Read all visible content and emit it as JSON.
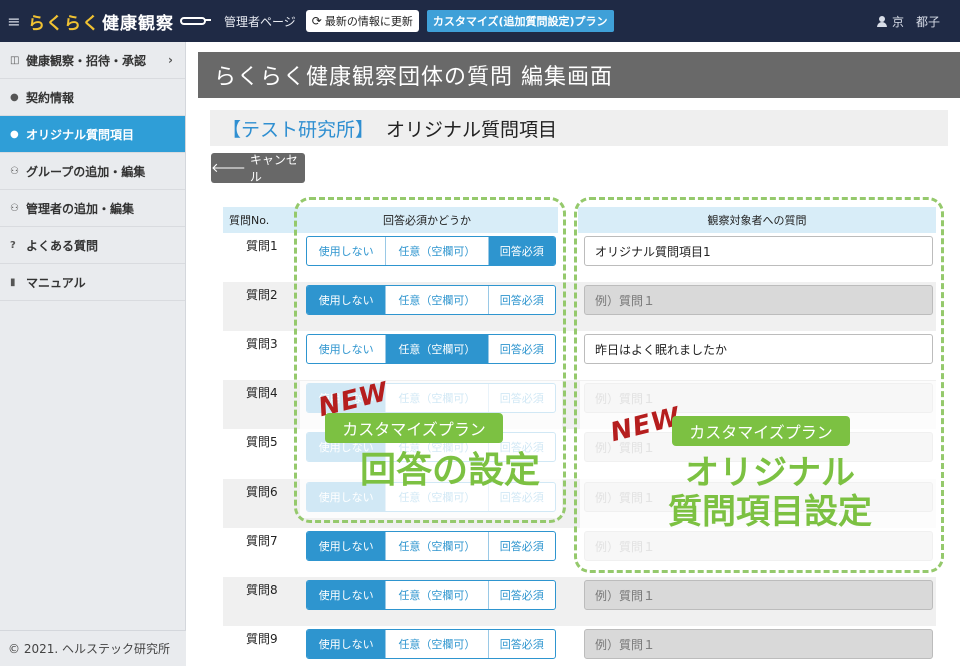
{
  "topbar": {
    "logo_part1": "らくらく",
    "logo_part2": "健康観察",
    "admin_page": "管理者ページ",
    "refresh_label": "最新の情報に更新",
    "plan_badge": "カスタマイズ(追加質問設定)プラン",
    "user_name": "京　都子"
  },
  "sidebar": {
    "items": [
      {
        "label": "健康観察・招待・承認",
        "icon": "table-icon"
      },
      {
        "label": "契約情報",
        "icon": "info-icon"
      },
      {
        "label": "オリジナル質問項目",
        "icon": "chat-bubble-icon"
      },
      {
        "label": "グループの追加・編集",
        "icon": "group-icon"
      },
      {
        "label": "管理者の追加・編集",
        "icon": "admin-group-icon"
      },
      {
        "label": "よくある質問",
        "icon": "question-icon"
      },
      {
        "label": "マニュアル",
        "icon": "book-icon"
      }
    ],
    "footer": "© 2021. ヘルステック研究所"
  },
  "main": {
    "page_title": "らくらく健康観察団体の質問 編集画面",
    "org_name": "【テスト研究所】",
    "section_title": "オリジナル質問項目",
    "cancel_label": "キャンセル",
    "columns": {
      "no": "質問No.",
      "answer_required": "回答必須かどうか",
      "question": "観察対象者への質問"
    },
    "segment_labels": [
      "使用しない",
      "任意（空欄可）",
      "回答必須"
    ],
    "rows": [
      {
        "label": "質問1",
        "selected": 2,
        "question": "オリジナル質問項目1",
        "disabled": false
      },
      {
        "label": "質問2",
        "selected": 0,
        "question": "例）質問１",
        "disabled": true
      },
      {
        "label": "質問3",
        "selected": 1,
        "question": "昨日はよく眠れましたか",
        "disabled": false
      },
      {
        "label": "質問4",
        "selected": 0,
        "question": "例）質問１",
        "disabled": true
      },
      {
        "label": "質問5",
        "selected": 0,
        "question": "例）質問１",
        "disabled": true
      },
      {
        "label": "質問6",
        "selected": 0,
        "question": "例）質問１",
        "disabled": true
      },
      {
        "label": "質問7",
        "selected": 0,
        "question": "例）質問１",
        "disabled": true
      },
      {
        "label": "質問8",
        "selected": 0,
        "question": "例）質問１",
        "disabled": true
      },
      {
        "label": "質問9",
        "selected": 0,
        "question": "例）質問１",
        "disabled": true
      }
    ]
  },
  "callouts": {
    "new_label": "NEW",
    "plan_tag": "カスタマイズプラン",
    "left_caption": "回答の設定",
    "right_caption_line1": "オリジナル",
    "right_caption_line2": "質問項目設定"
  },
  "colors": {
    "accent": "#2e95cf",
    "topbar": "#1f2a45",
    "callout_green": "#7cc142",
    "new_red": "#b51e1e"
  }
}
